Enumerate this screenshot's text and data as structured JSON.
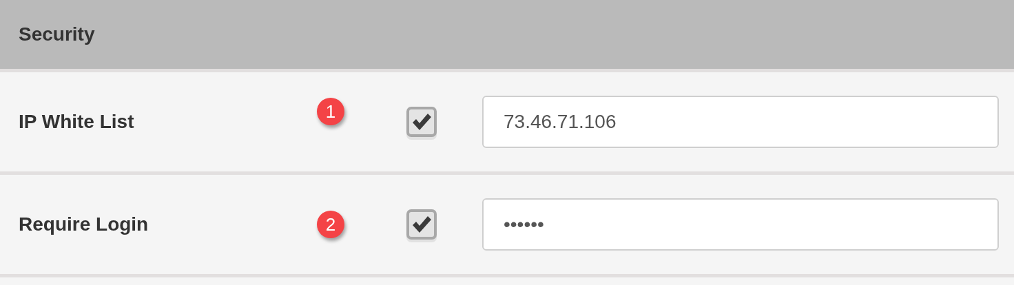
{
  "section": {
    "title": "Security"
  },
  "rows": [
    {
      "label": "IP White List",
      "badge": "1",
      "checked": true,
      "value": "73.46.71.106"
    },
    {
      "label": "Require Login",
      "badge": "2",
      "checked": true,
      "value": "••••••"
    }
  ]
}
